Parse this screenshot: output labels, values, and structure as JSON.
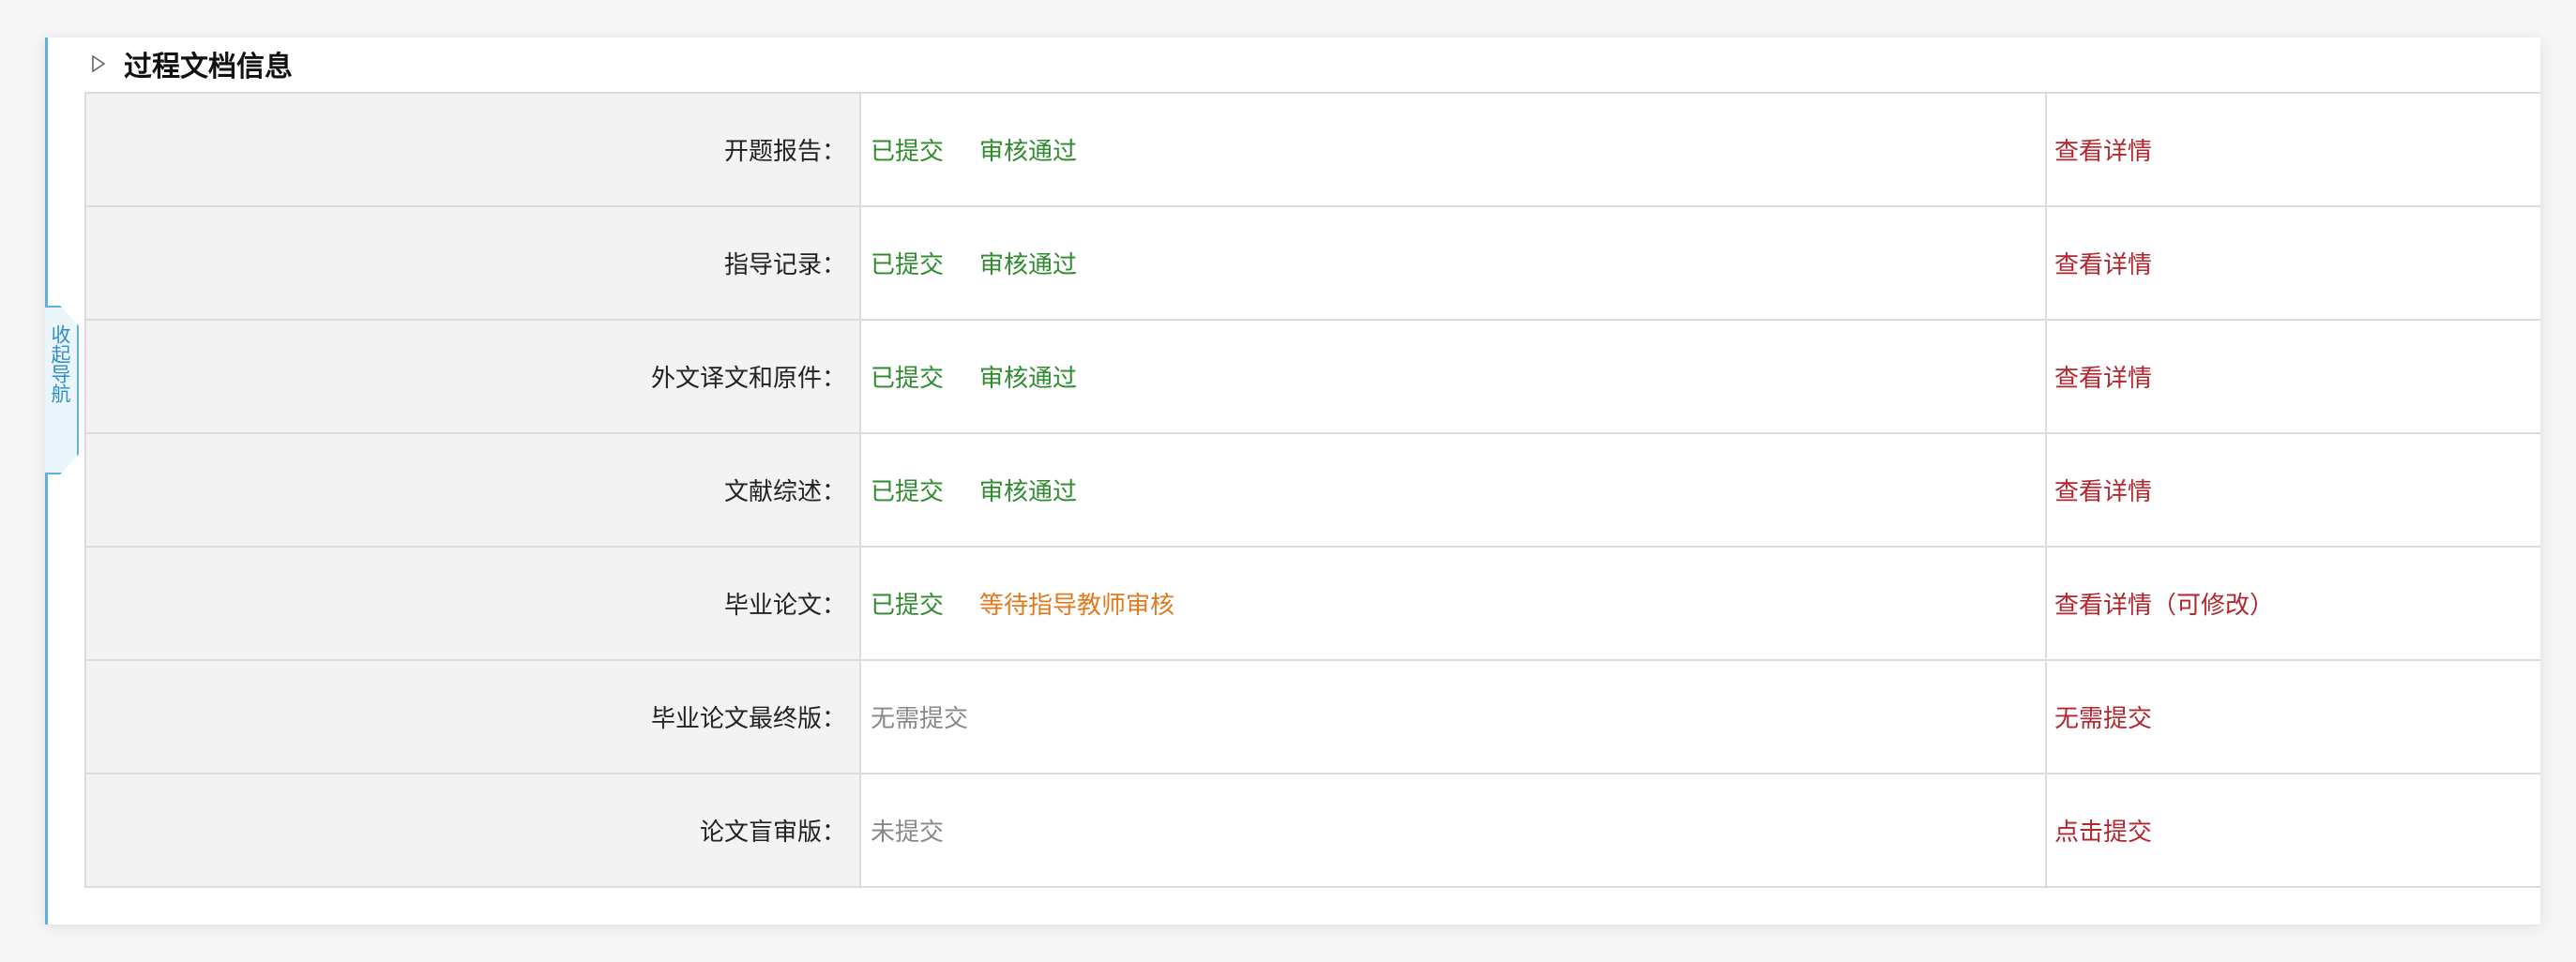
{
  "nav": {
    "toggle_label": "收起导航"
  },
  "section": {
    "title": "过程文档信息"
  },
  "rows": [
    {
      "label": "开题报告：",
      "submit_status": "已提交",
      "review_status": "审核通过",
      "review_kind": "pass",
      "action": "查看详情"
    },
    {
      "label": "指导记录：",
      "submit_status": "已提交",
      "review_status": "审核通过",
      "review_kind": "pass",
      "action": "查看详情"
    },
    {
      "label": "外文译文和原件：",
      "submit_status": "已提交",
      "review_status": "审核通过",
      "review_kind": "pass",
      "action": "查看详情"
    },
    {
      "label": "文献综述：",
      "submit_status": "已提交",
      "review_status": "审核通过",
      "review_kind": "pass",
      "action": "查看详情"
    },
    {
      "label": "毕业论文：",
      "submit_status": "已提交",
      "review_status": "等待指导教师审核",
      "review_kind": "wait",
      "action": "查看详情（可修改）"
    },
    {
      "label": "毕业论文最终版：",
      "submit_status": "无需提交",
      "review_status": "",
      "review_kind": "none",
      "action": "无需提交"
    },
    {
      "label": "论文盲审版：",
      "submit_status": "未提交",
      "review_status": "",
      "review_kind": "none",
      "action": "点击提交"
    }
  ],
  "colors": {
    "submitted": "#2e8b2e",
    "pending": "#e07a1f",
    "inactive": "#888888",
    "action": "#b3262e",
    "nav_accent": "#5bb2dc"
  }
}
